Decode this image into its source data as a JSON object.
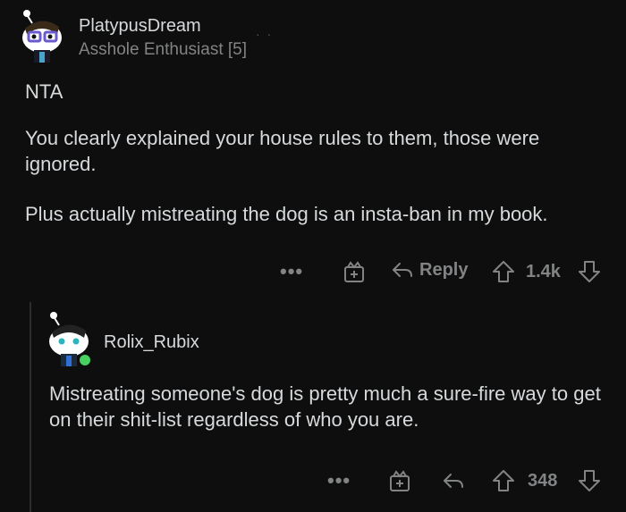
{
  "comments": [
    {
      "username": "PlatypusDream",
      "flair": "Asshole Enthusiast [5]",
      "paragraphs": [
        "NTA",
        "You clearly explained your house rules to them, those were ignored.",
        "Plus actually mistreating the dog is an insta-ban in my book."
      ],
      "actions": {
        "more": "•••",
        "reply_label": "Reply",
        "score": "1.4k"
      },
      "colors": {
        "avatar_accent": "#6a5acd"
      }
    },
    {
      "username": "Rolix_Rubix",
      "paragraphs": [
        "Mistreating someone's dog is pretty much a sure-fire way to get on their shit-list regardless of who you are."
      ],
      "actions": {
        "more": "•••",
        "score": "348"
      },
      "colors": {
        "online_dot": "#46d160",
        "avatar_accent": "#2bb3c0"
      }
    }
  ]
}
